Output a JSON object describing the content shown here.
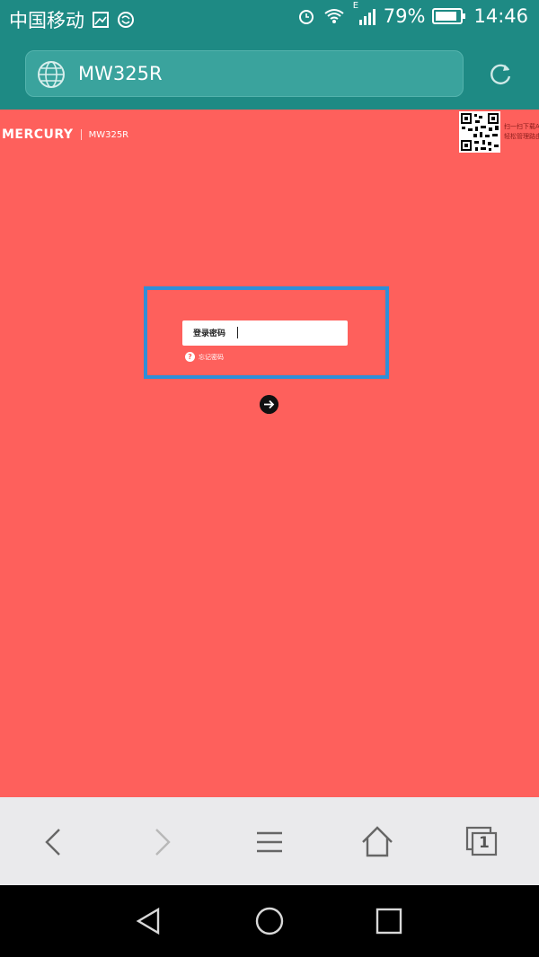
{
  "status_bar": {
    "carrier": "中国移动",
    "network_type": "E",
    "battery_percent": "79%",
    "time": "14:46",
    "icons": [
      "image-icon",
      "sync-icon",
      "alarm-icon",
      "wifi-icon",
      "signal-icon",
      "battery-icon"
    ]
  },
  "browser": {
    "url": "MW325R"
  },
  "page": {
    "brand": "MERCURY",
    "model": "MW325R",
    "qr_caption_line1": "扫一扫下载A",
    "qr_caption_line2": "轻松管理路由",
    "password_label": "登录密码",
    "forgot_password": "忘记密码",
    "forgot_icon_glyph": "?",
    "background_color": "#fe605c",
    "highlight_color": "#2f8fd8"
  },
  "toolbar": {
    "icons": [
      "back-icon",
      "forward-icon",
      "menu-icon",
      "home-icon",
      "tabs-icon"
    ],
    "tab_count": "1"
  },
  "nav": {
    "icons": [
      "nav-back-icon",
      "nav-home-icon",
      "nav-recents-icon"
    ]
  }
}
